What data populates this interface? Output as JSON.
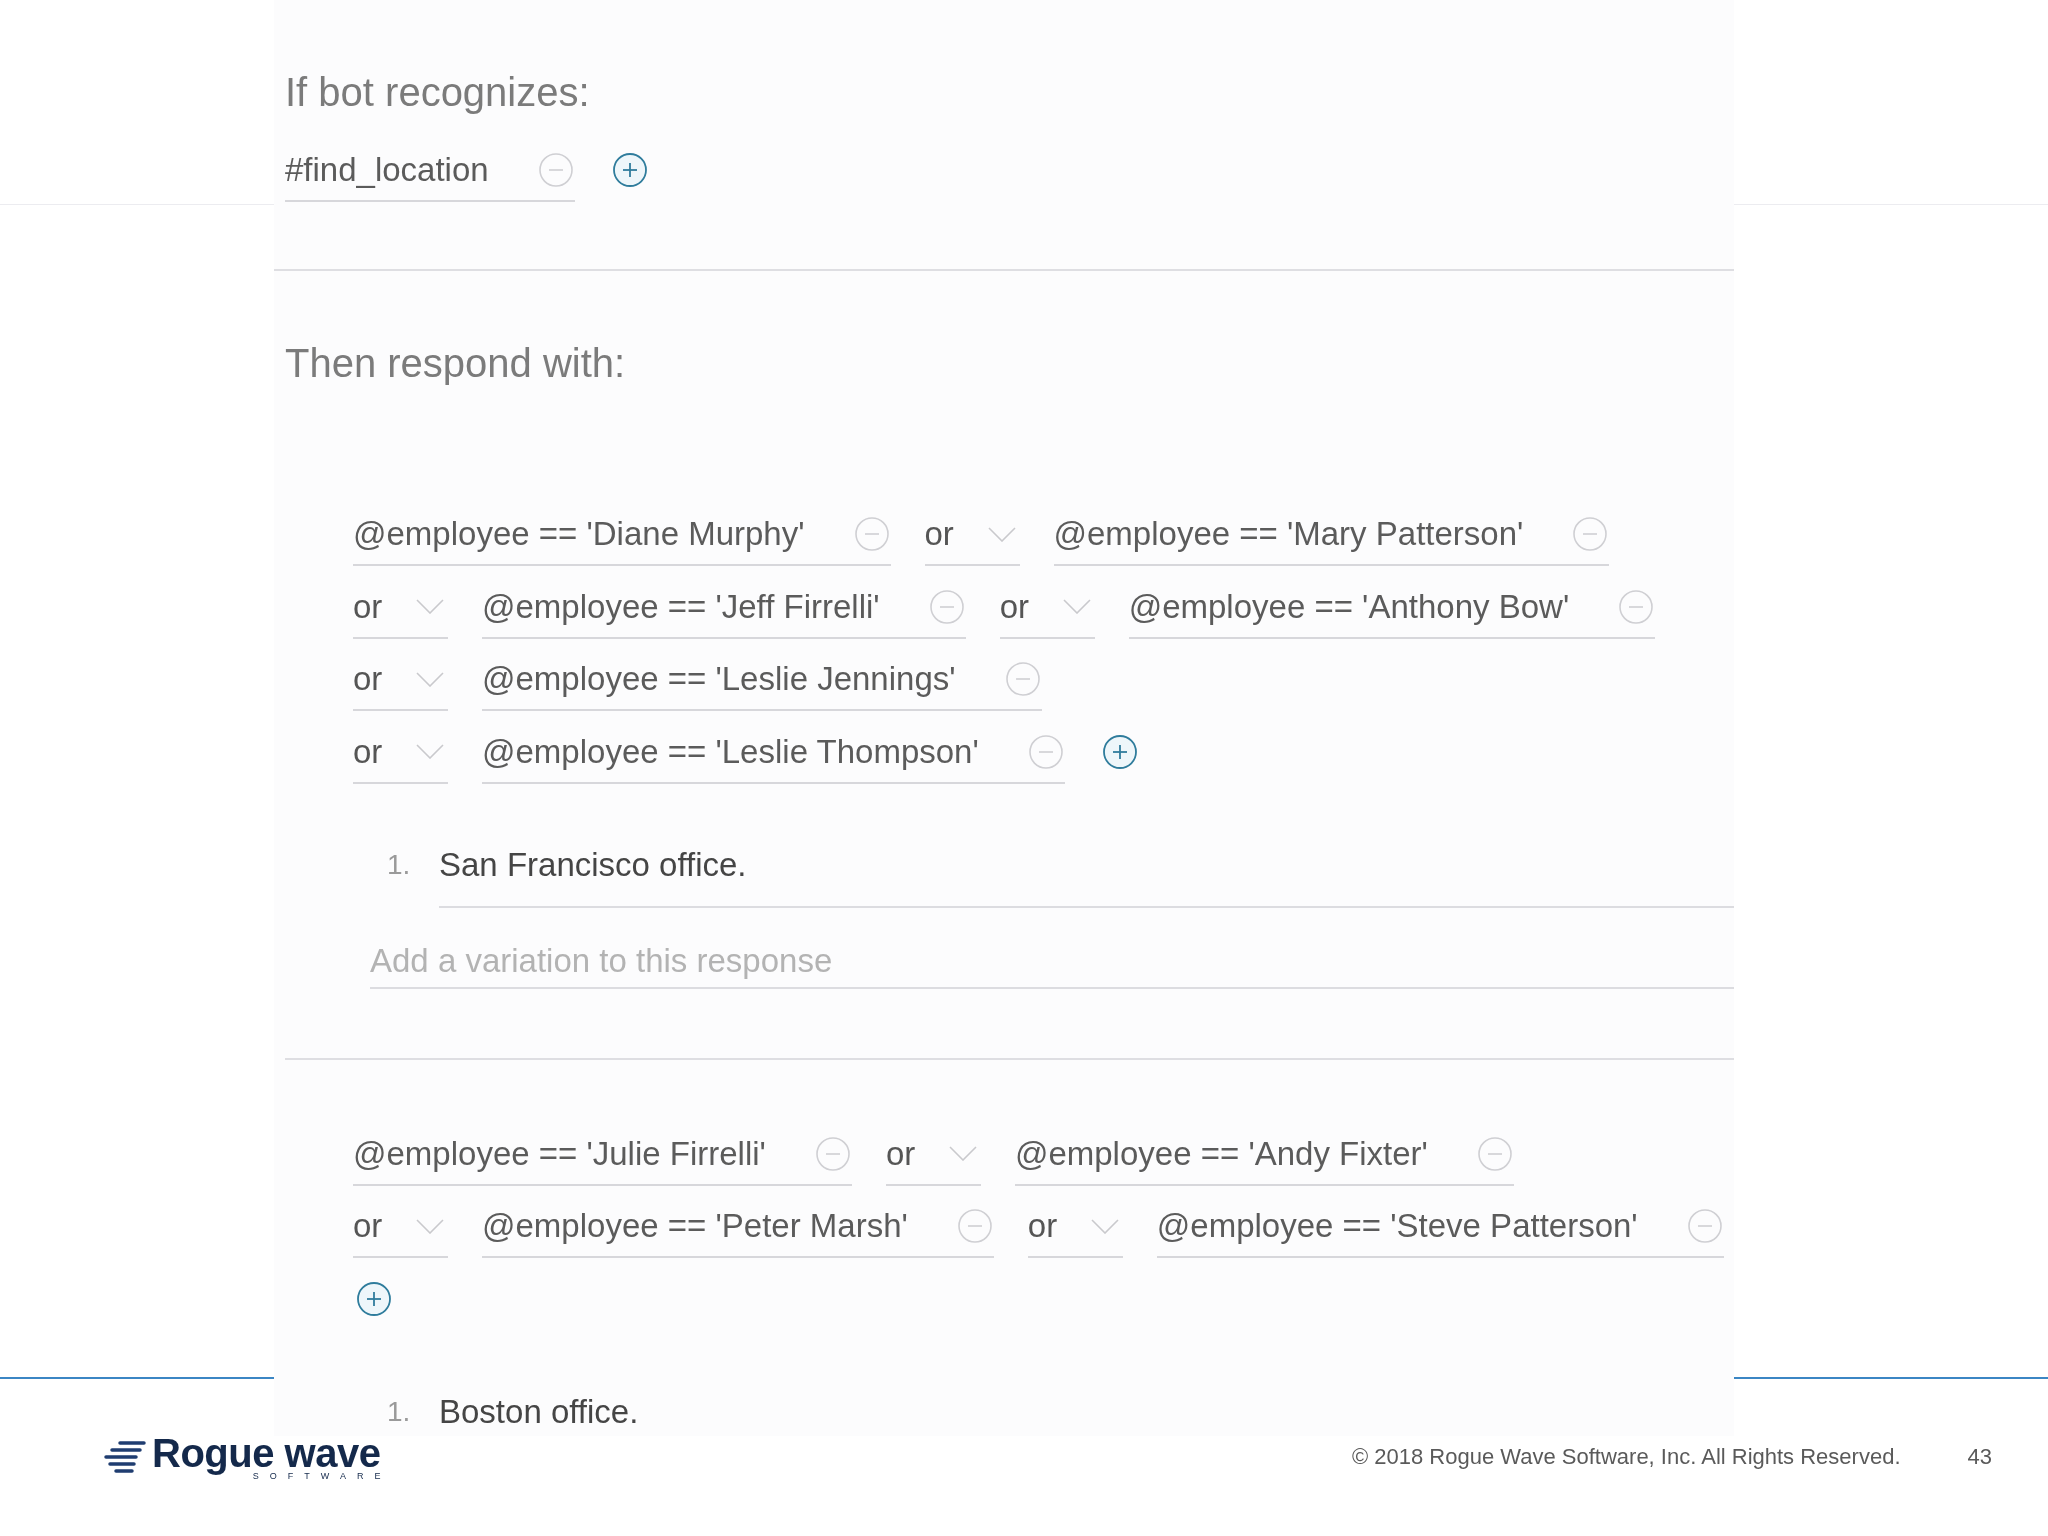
{
  "trigger": {
    "heading": "If bot recognizes:",
    "conditions": [
      {
        "value": "#find_location"
      }
    ]
  },
  "response_section": {
    "heading": "Then respond with:",
    "blocks": [
      {
        "conditions": [
          {
            "value": "@employee == 'Diane Murphy'"
          },
          {
            "operator": "or",
            "value": "@employee == 'Mary Patterson'"
          },
          {
            "operator": "or",
            "value": "@employee == 'Jeff Firrelli'"
          },
          {
            "operator": "or",
            "value": "@employee == 'Anthony Bow'"
          },
          {
            "operator": "or",
            "value": "@employee == 'Leslie Jennings'"
          },
          {
            "operator": "or",
            "value": "@employee == 'Leslie Thompson'"
          }
        ],
        "responses": [
          {
            "number": "1.",
            "text": "San Francisco office."
          }
        ],
        "variation_field": {
          "placeholder": "Add a variation to this response"
        }
      },
      {
        "conditions": [
          {
            "value": "@employee == 'Julie Firrelli'"
          },
          {
            "operator": "or",
            "value": "@employee == 'Andy Fixter'"
          },
          {
            "operator": "or",
            "value": "@employee == 'Peter Marsh'"
          },
          {
            "operator": "or",
            "value": "@employee == 'Steve Patterson'"
          }
        ],
        "responses": [
          {
            "number": "1.",
            "text": "Boston office."
          }
        ]
      }
    ]
  },
  "footer": {
    "logo": {
      "wordmark": "Rogue wave",
      "tagline": "SOFTWARE"
    },
    "copyright": "© 2018 Rogue Wave Software, Inc. All Rights Reserved.",
    "page_number": "43"
  }
}
